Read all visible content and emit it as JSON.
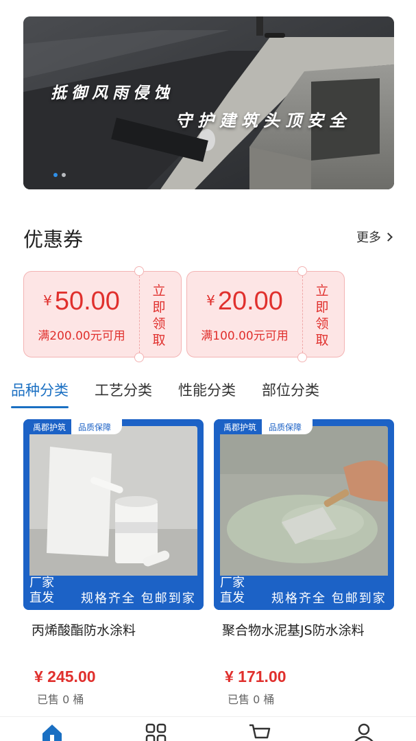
{
  "banner": {
    "slogan_line1": "抵御风雨侵蚀",
    "slogan_line2": "守护建筑头顶安全",
    "slide_count": 2,
    "active_slide": 1
  },
  "coupons": {
    "title": "优惠券",
    "more_label": "更多",
    "items": [
      {
        "currency": "¥",
        "amount": "50.00",
        "condition": "满200.00元可用",
        "claim_label": "立即领取"
      },
      {
        "currency": "¥",
        "amount": "20.00",
        "condition": "满100.00元可用",
        "claim_label": "立即领取"
      }
    ]
  },
  "category_tabs": [
    {
      "label": "品种分类",
      "active": true
    },
    {
      "label": "工艺分类",
      "active": false
    },
    {
      "label": "性能分类",
      "active": false
    },
    {
      "label": "部位分类",
      "active": false
    }
  ],
  "products": [
    {
      "brand": "禹郡护筑",
      "badge": "品质保障",
      "direct": "厂家直发",
      "slogan": "规格齐全 包邮到家",
      "name": "丙烯酸酯防水涂料",
      "price": "¥ 245.00",
      "sold": "已售 0 桶"
    },
    {
      "brand": "禹郡护筑",
      "badge": "品质保障",
      "direct": "厂家直发",
      "slogan": "规格齐全 包邮到家",
      "name": "聚合物水泥基JS防水涂料",
      "price": "¥ 171.00",
      "sold": "已售 0 桶"
    }
  ],
  "bottom_nav": {
    "items": [
      {
        "icon": "home-icon",
        "active": true
      },
      {
        "icon": "category-icon",
        "active": false
      },
      {
        "icon": "cart-icon",
        "active": false
      },
      {
        "icon": "user-icon",
        "active": false
      }
    ]
  },
  "colors": {
    "accent": "#1a6fc2",
    "price_red": "#e0302d",
    "coupon_bg": "#fde5e5",
    "card_blue": "#1c62c6"
  }
}
